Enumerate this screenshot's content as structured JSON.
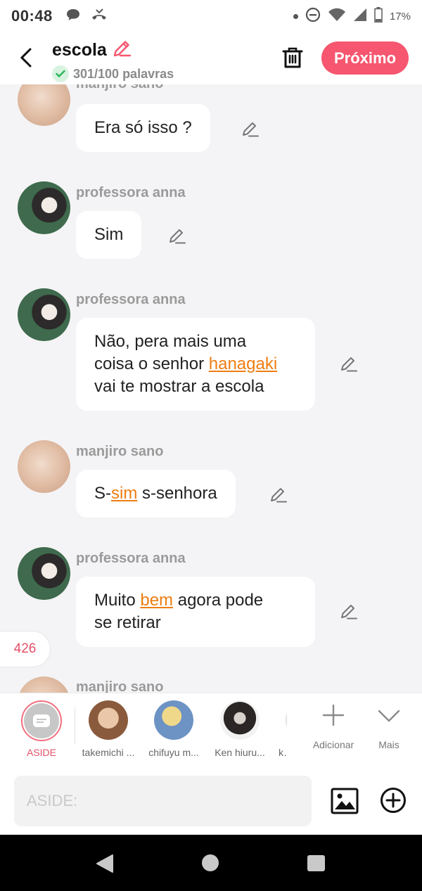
{
  "status_bar": {
    "time": "00:48",
    "battery": "17%"
  },
  "header": {
    "title": "escola",
    "word_count": "301/100 palavras",
    "next_label": "Próximo"
  },
  "messages": [
    {
      "sender": "manjiro sano",
      "text": "Era só isso ?"
    },
    {
      "sender": "professora anna",
      "text": "Sim"
    },
    {
      "sender": "professora anna",
      "line1": "Não, pera mais uma",
      "line2_a": "coisa o senhor ",
      "line2_hl": "hanagaki",
      "line3": "vai te mostrar a escola"
    },
    {
      "sender": "manjiro sano",
      "pre": "S-",
      "hl": "sim",
      "post": " s-senhora"
    },
    {
      "sender": "professora anna",
      "pre": "Muito ",
      "hl": "bem",
      "post": " agora pode",
      "line2": "se retirar"
    },
    {
      "sender": "manjiro sano"
    }
  ],
  "counter": "426",
  "characters": [
    {
      "label": "ASIDE"
    },
    {
      "label": "takemichi ..."
    },
    {
      "label": "chifuyu m..."
    },
    {
      "label": "Ken hiuru..."
    },
    {
      "label": "ke"
    }
  ],
  "tools": {
    "add_label": "Adicionar",
    "more_label": "Mais"
  },
  "composer": {
    "placeholder": "ASIDE:"
  },
  "colors": {
    "accent": "#f6566f",
    "highlight": "#ef7d12"
  }
}
